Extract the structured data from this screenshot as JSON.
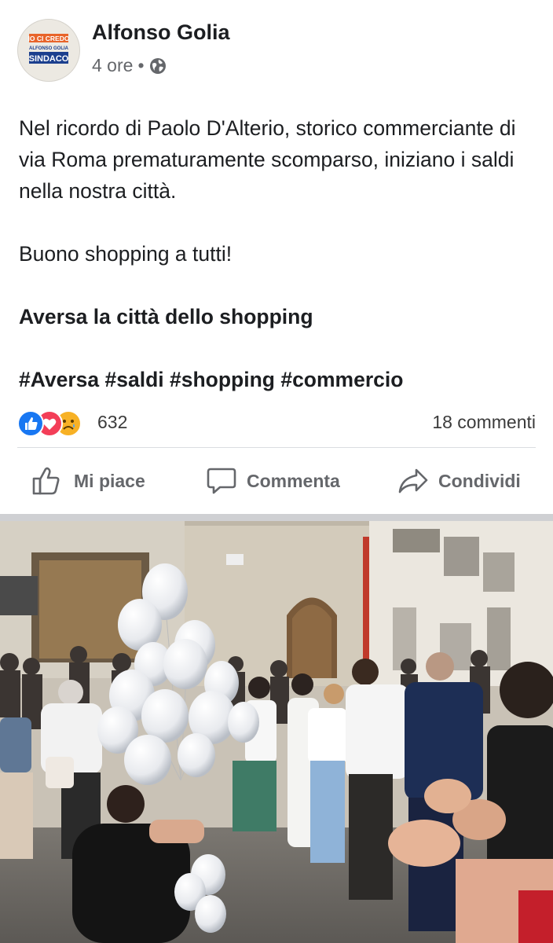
{
  "post": {
    "author": "Alfonso Golia",
    "time": "4 ore",
    "separator_dot": "•",
    "privacy_icon": "globe-icon",
    "avatar_text": {
      "line1": "IO CI CREDO",
      "line2": "ALFONSO GOLIA",
      "line3": "SINDACO"
    },
    "text": {
      "paragraph1": "Nel ricordo di Paolo D'Alterio, storico commerciante di via Roma prematuramente scomparso, iniziano i saldi nella nostra città.",
      "paragraph2": "Buono shopping a tutti!",
      "paragraph3": "Aversa la città dello shopping",
      "hashtags": "#Aversa #saldi #shopping #commercio"
    },
    "reactions": {
      "icons": [
        "like-icon",
        "love-icon",
        "sad-icon"
      ],
      "count": "632"
    },
    "comments": "18 commenti",
    "actions": {
      "like": "Mi piace",
      "comment": "Commenta",
      "share": "Condividi"
    }
  },
  "colors": {
    "like_blue": "#1877f2",
    "love_red": "#f33e58",
    "sad_yellow": "#f7b125",
    "action_gray": "#65676b",
    "text_dark": "#1c1e21",
    "avatar_blue": "#1b3f8e",
    "avatar_orange": "#e8642a"
  },
  "photo": {
    "content": "crowd-with-white-balloons-photo"
  }
}
